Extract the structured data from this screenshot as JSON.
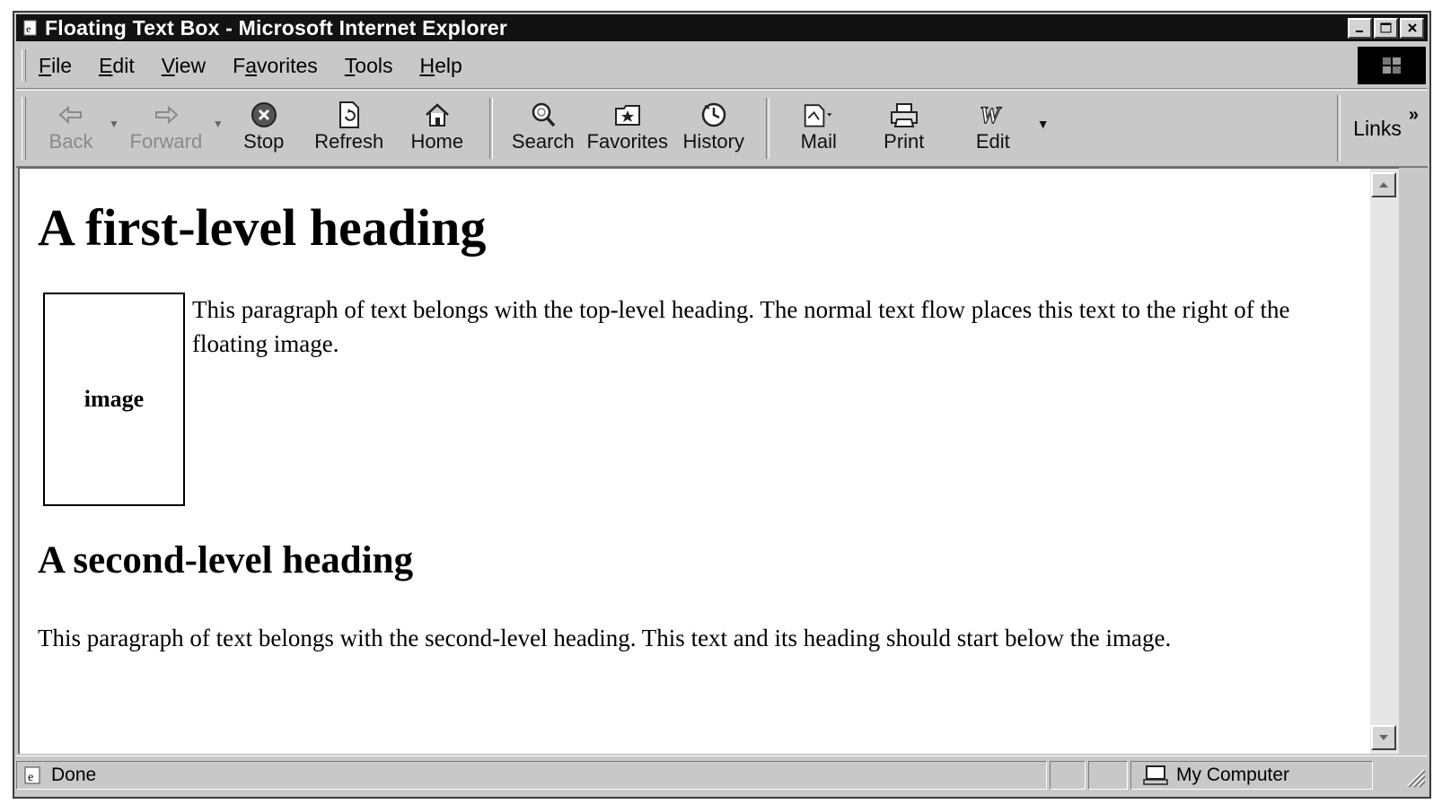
{
  "window": {
    "title": "Floating Text Box - Microsoft Internet Explorer",
    "controls": [
      "minimize",
      "maximize",
      "close"
    ]
  },
  "menubar": {
    "items": [
      {
        "label": "File",
        "underline": "F"
      },
      {
        "label": "Edit",
        "underline": "E"
      },
      {
        "label": "View",
        "underline": "V"
      },
      {
        "label": "Favorites",
        "underline": "a"
      },
      {
        "label": "Tools",
        "underline": "T"
      },
      {
        "label": "Help",
        "underline": "H"
      }
    ]
  },
  "toolbar": {
    "back": "Back",
    "forward": "Forward",
    "stop": "Stop",
    "refresh": "Refresh",
    "home": "Home",
    "search": "Search",
    "favorites": "Favorites",
    "history": "History",
    "mail": "Mail",
    "print": "Print",
    "edit": "Edit",
    "links": "Links",
    "links_chevron": "»"
  },
  "page": {
    "h1": "A first-level heading",
    "image_label": "image",
    "p1": "This paragraph of text belongs with the top-level heading. The normal text flow places this text to the right of the floating image.",
    "h2": "A second-level heading",
    "p2": "This paragraph of text belongs with the second-level heading. This text and its heading should start below the image."
  },
  "statusbar": {
    "status": "Done",
    "zone": "My Computer"
  },
  "icons": {
    "back": "arrow-left-icon",
    "forward": "arrow-right-icon",
    "stop": "stop-icon",
    "refresh": "refresh-icon",
    "home": "home-icon",
    "search": "search-icon",
    "favorites": "favorites-icon",
    "history": "history-icon",
    "mail": "mail-icon",
    "print": "printer-icon",
    "edit": "edit-icon"
  }
}
